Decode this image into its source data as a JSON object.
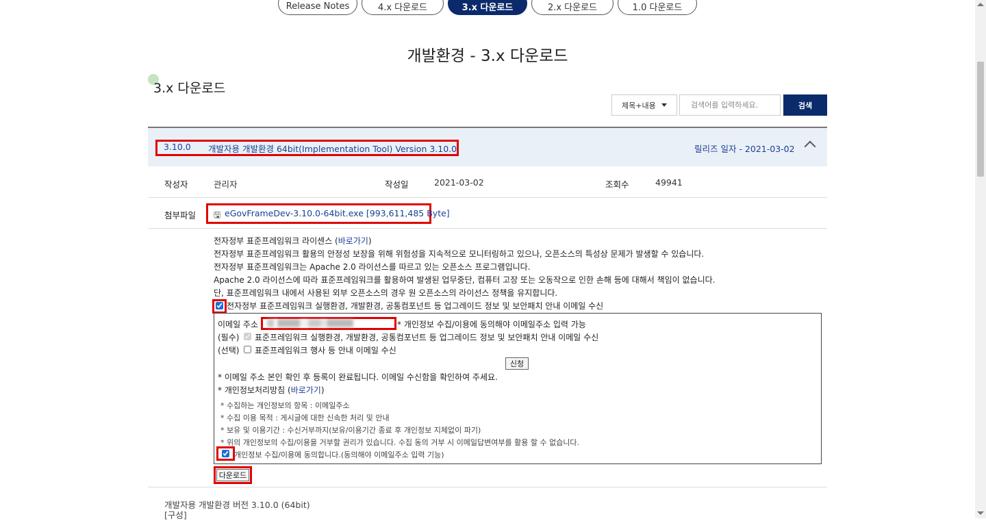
{
  "tabs": [
    "Release Notes",
    "4.x 다운로드",
    "3.x 다운로드",
    "2.x 다운로드",
    "1.0 다운로드"
  ],
  "page_title": "개발환경 - 3.x 다운로드",
  "section_title": "3.x 다운로드",
  "search": {
    "select_label": "제목+내용",
    "placeholder": "검색어를 입력하세요.",
    "button": "검색"
  },
  "release": {
    "version": "3.10.0",
    "title": "개발자용 개발환경 64bit(Implementation Tool) Version 3.10.0",
    "release_date": "릴리즈 일자 - 2021-03-02"
  },
  "meta": {
    "author_label": "작성자",
    "author": "관리자",
    "date_label": "작성일",
    "date": "2021-03-02",
    "views_label": "조회수",
    "views": "49941"
  },
  "attachment": {
    "label": "첨부파일",
    "file": "eGovFrameDev-3.10.0-64bit.exe [993,611,485 Byte]"
  },
  "license": {
    "line1_pre": "전자정부 표준프레임워크 라이센스 (",
    "line1_link": "바로가기",
    "line1_post": ")",
    "line2": "전자정부 표준프레임워크 활용의 안정성 보장을 위해 위험성을 지속적으로 모니터링하고 있으나, 오픈소스의 특성상 문제가 발생할 수 있습니다.",
    "line3": "전자정부 표준프레임워크는 Apache 2.0 라이선스를 따르고 있는 오픈소스 프로그램입니다.",
    "line4": "Apache 2.0 라이선스에 따라 표준프레임워크를 활용하여 발생된 업무중단, 컴퓨터 고장 또는 오동작으로 인한 손해 등에 대해서 책임이 없습니다.",
    "line5": "단, 표준프레임워크 내에서 사용된 외부 오픈소스의 경우 원 오픈소스의 라이선스 정책을 유지합니다.",
    "subscribe": "전자정부 표준프레임워크 실행환경, 개발환경, 공통컴포넌트 등 업그레이드 정보 및 보안패치 안내 이메일 수신"
  },
  "form": {
    "email_label": "이메일 주소 :",
    "email_note": "* 개인정보 수집/이용에 동의해야 이메일주소 입력 가능",
    "required_prefix": "(필수)",
    "required_text": "표준프레임워크 실행환경, 개발환경, 공통컴포넌트 등 업그레이드 정보 및 보안패치 안내 이메일 수신",
    "optional_prefix": "(선택)",
    "optional_text": "표준프레임워크 행사 등 안내 이메일 수신",
    "apply_button": "신청",
    "confirm_note": "* 이메일 주소 본인 확인 후 등록이 완료됩니다. 이메일 수신함을 확인하여 주세요.",
    "privacy_pre": "* 개인정보처리방침 (",
    "privacy_link": "바로가기",
    "privacy_post": ")",
    "items": [
      "* 수집하는 개인정보의 항목 : 이메일주소",
      "* 수집 이용 목적 : 게시글에 대한 신속한 처리 및 안내",
      "* 보유 및 이용기간 : 수신거부까지(보유/이용기간 종료 후 개인정보 지체없이 파기)",
      "* 위의 개인정보의 수집/이용을 거부할 권리가 있습니다. 수집 동의 거부 시 이메일답변여부를 활용 할 수 없습니다."
    ],
    "agree": "개인정보 수집/이용에 동의합니다.(동의해야 이메일주소 입력 기능)",
    "download_button": "다운로드"
  },
  "footer": {
    "line1": "개발자용 개발환경 버전 3.10.0 (64bit)",
    "line2": "[구성]"
  }
}
